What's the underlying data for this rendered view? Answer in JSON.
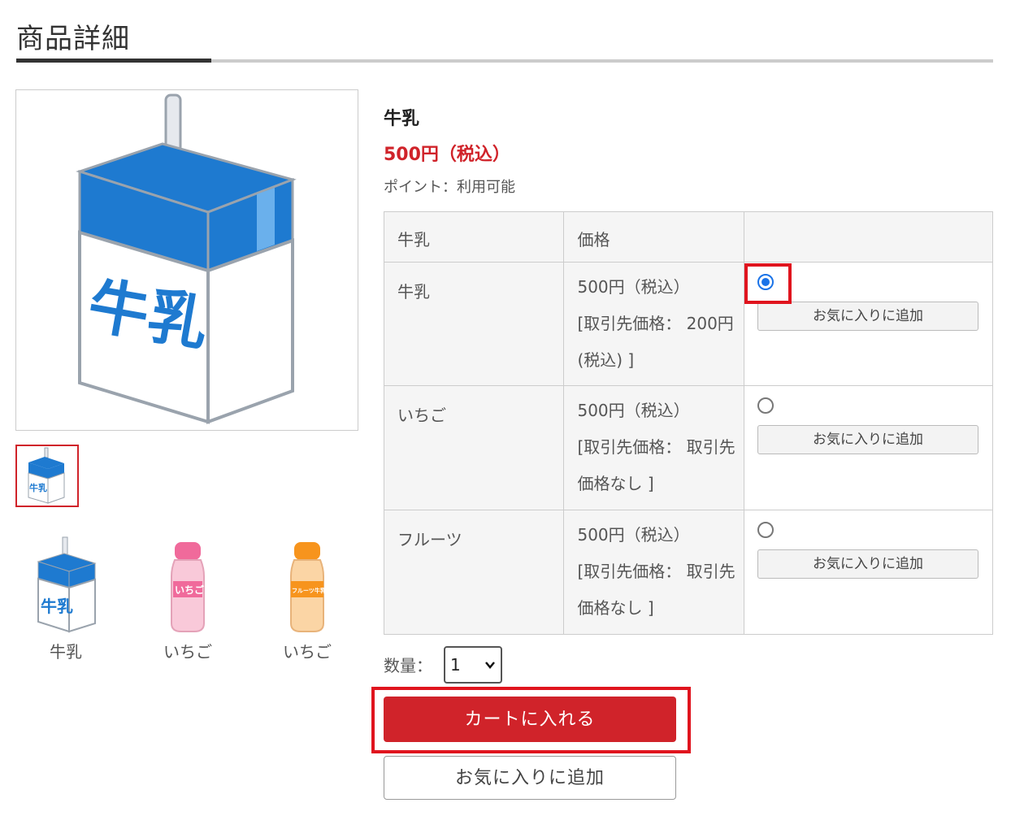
{
  "page": {
    "title": "商品詳細"
  },
  "product": {
    "name": "牛乳",
    "price": "500円（税込）",
    "points": "ポイント：利用可能",
    "image_text": "牛乳"
  },
  "table": {
    "headers": [
      "牛乳",
      "価格",
      ""
    ],
    "rows": [
      {
        "variant": "牛乳",
        "price": "500円（税込）",
        "partner_price": "[取引先価格： 200円(税込) ]",
        "selected": true,
        "favorite_label": "お気に入りに追加"
      },
      {
        "variant": "いちご",
        "price": "500円（税込）",
        "partner_price": "[取引先価格： 取引先価格なし ]",
        "selected": false,
        "favorite_label": "お気に入りに追加"
      },
      {
        "variant": "フルーツ",
        "price": "500円（税込）",
        "partner_price": "[取引先価格： 取引先価格なし ]",
        "selected": false,
        "favorite_label": "お気に入りに追加"
      }
    ]
  },
  "related": [
    {
      "label": "牛乳",
      "image_text": "牛乳",
      "color": "#1e7ad0"
    },
    {
      "label": "いちご",
      "image_text": "いちご",
      "color": "#f06a9b"
    },
    {
      "label": "いちご",
      "image_text": "フルーツ牛乳",
      "color": "#f7941d"
    }
  ],
  "quantity": {
    "label": "数量：",
    "value": "1"
  },
  "buttons": {
    "add_to_cart": "カートに入れる",
    "add_to_favorites": "お気に入りに追加"
  },
  "colors": {
    "accent_red": "#d0232a",
    "highlight_red": "#e0141e",
    "milk_blue": "#1e7ad0"
  }
}
